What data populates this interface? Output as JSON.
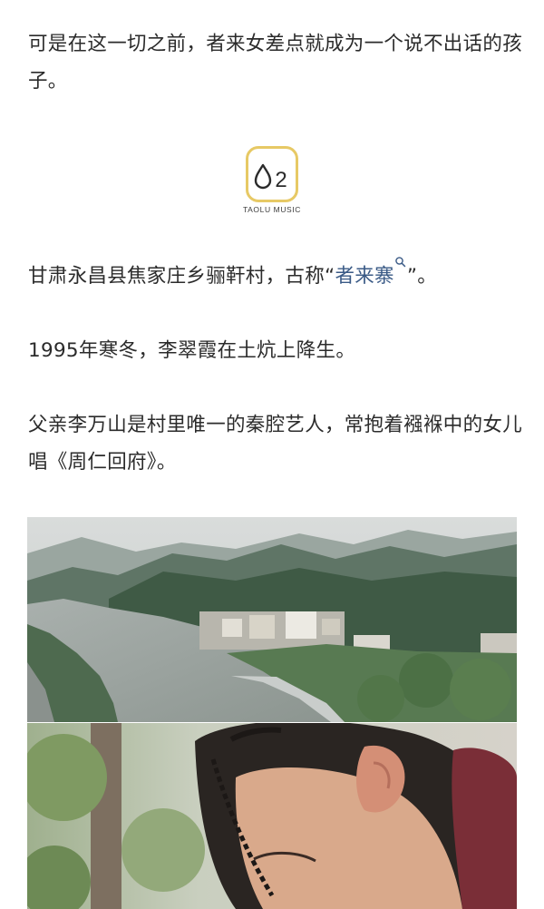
{
  "paragraphs": {
    "p1": "可是在这一切之前，者来女差点就成为一个说不出话的孩子。",
    "p2_before": "甘肃永昌县焦家庄乡骊靬村，古称“",
    "p2_keyword": "者来寨",
    "p2_after": "”。",
    "p3": "1995年寒冬，李翠霞在土炕上降生。",
    "p4": "父亲李万山是村里唯一的秦腔艺人，常抱着襁褓中的女儿唱《周仁回府》。"
  },
  "logo": {
    "number": "02",
    "subtitle": "TAOLU MUSIC",
    "accent_color": "#e7c965"
  },
  "colors": {
    "text": "#2b2b2b",
    "keyword": "#3a5a86"
  },
  "icons": {
    "keyword_search": "search-icon"
  }
}
